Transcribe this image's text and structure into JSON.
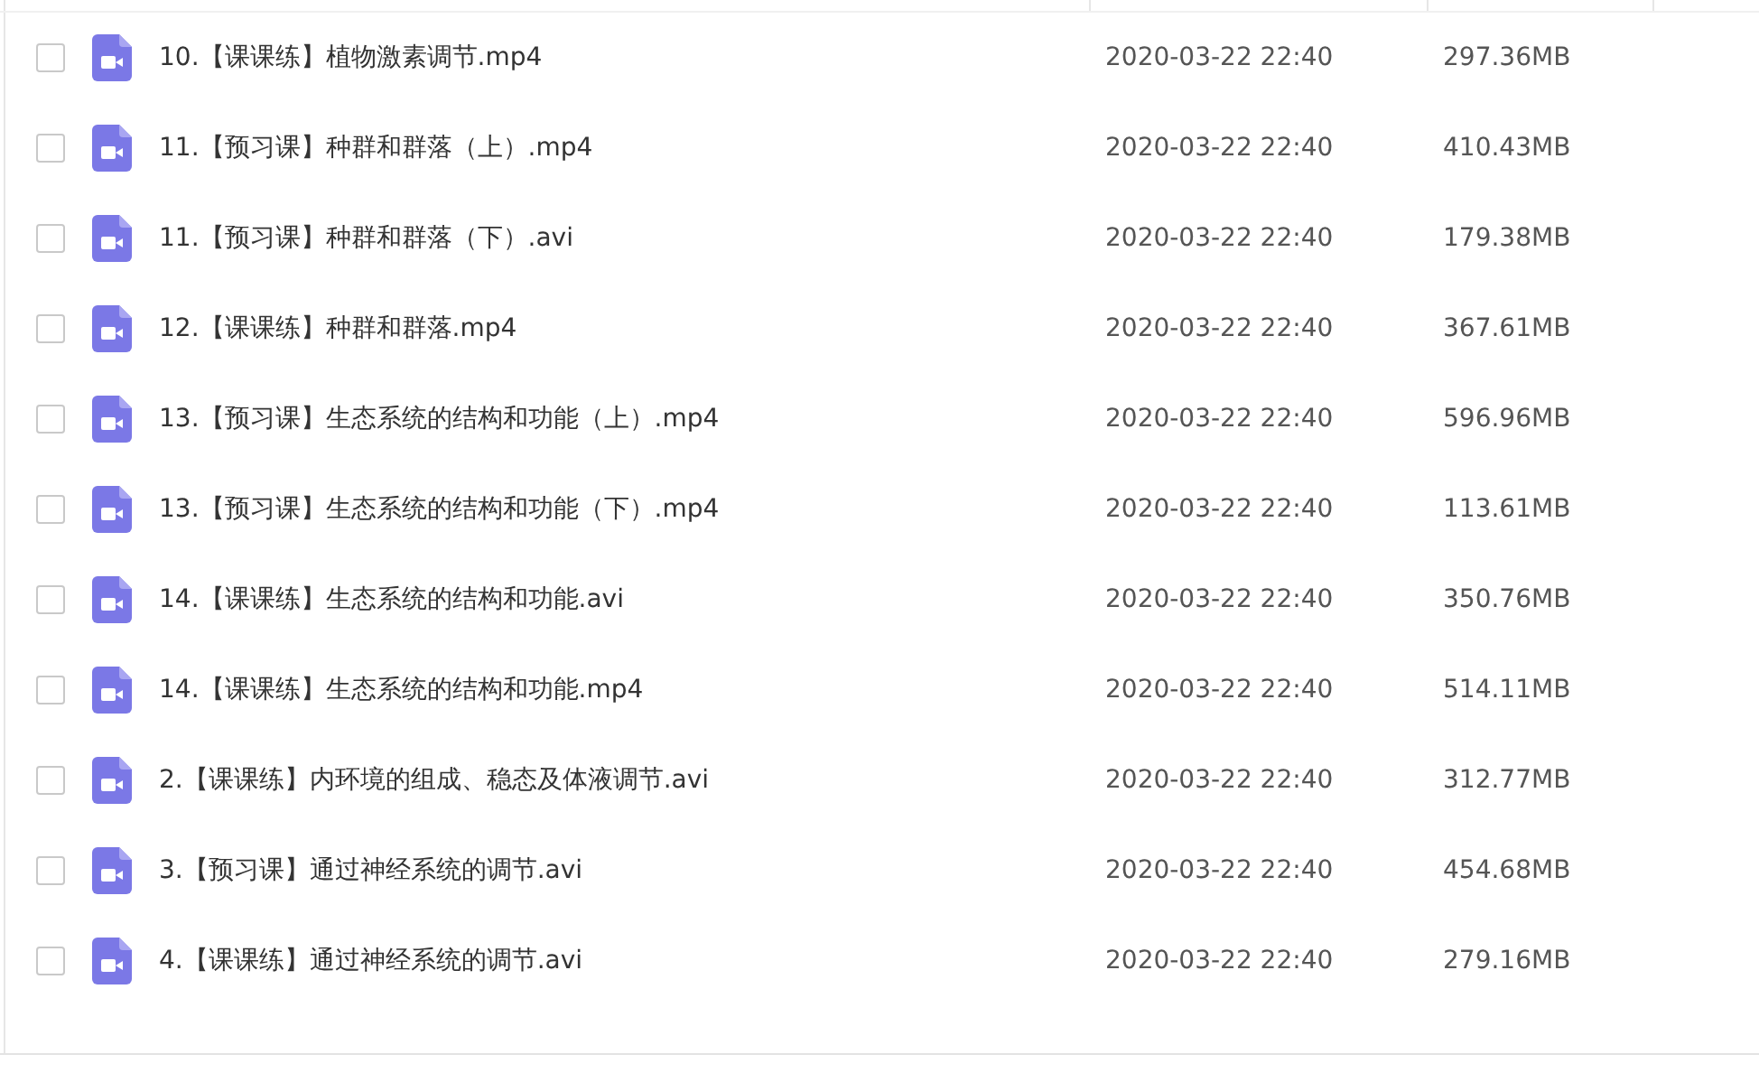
{
  "files": [
    {
      "name": "10.【课课练】植物激素调节.mp4",
      "modified": "2020-03-22 22:40",
      "size": "297.36MB",
      "checked": false
    },
    {
      "name": "11.【预习课】种群和群落（上）.mp4",
      "modified": "2020-03-22 22:40",
      "size": "410.43MB",
      "checked": false
    },
    {
      "name": "11.【预习课】种群和群落（下）.avi",
      "modified": "2020-03-22 22:40",
      "size": "179.38MB",
      "checked": false
    },
    {
      "name": "12.【课课练】种群和群落.mp4",
      "modified": "2020-03-22 22:40",
      "size": "367.61MB",
      "checked": false
    },
    {
      "name": "13.【预习课】生态系统的结构和功能（上）.mp4",
      "modified": "2020-03-22 22:40",
      "size": "596.96MB",
      "checked": false
    },
    {
      "name": "13.【预习课】生态系统的结构和功能（下）.mp4",
      "modified": "2020-03-22 22:40",
      "size": "113.61MB",
      "checked": false
    },
    {
      "name": "14.【课课练】生态系统的结构和功能.avi",
      "modified": "2020-03-22 22:40",
      "size": "350.76MB",
      "checked": false
    },
    {
      "name": "14.【课课练】生态系统的结构和功能.mp4",
      "modified": "2020-03-22 22:40",
      "size": "514.11MB",
      "checked": false
    },
    {
      "name": "2.【课课练】内环境的组成、稳态及体液调节.avi",
      "modified": "2020-03-22 22:40",
      "size": "312.77MB",
      "checked": false
    },
    {
      "name": "3.【预习课】通过神经系统的调节.avi",
      "modified": "2020-03-22 22:40",
      "size": "454.68MB",
      "checked": false
    },
    {
      "name": "4.【课课练】通过神经系统的调节.avi",
      "modified": "2020-03-22 22:40",
      "size": "279.16MB",
      "checked": false
    }
  ]
}
